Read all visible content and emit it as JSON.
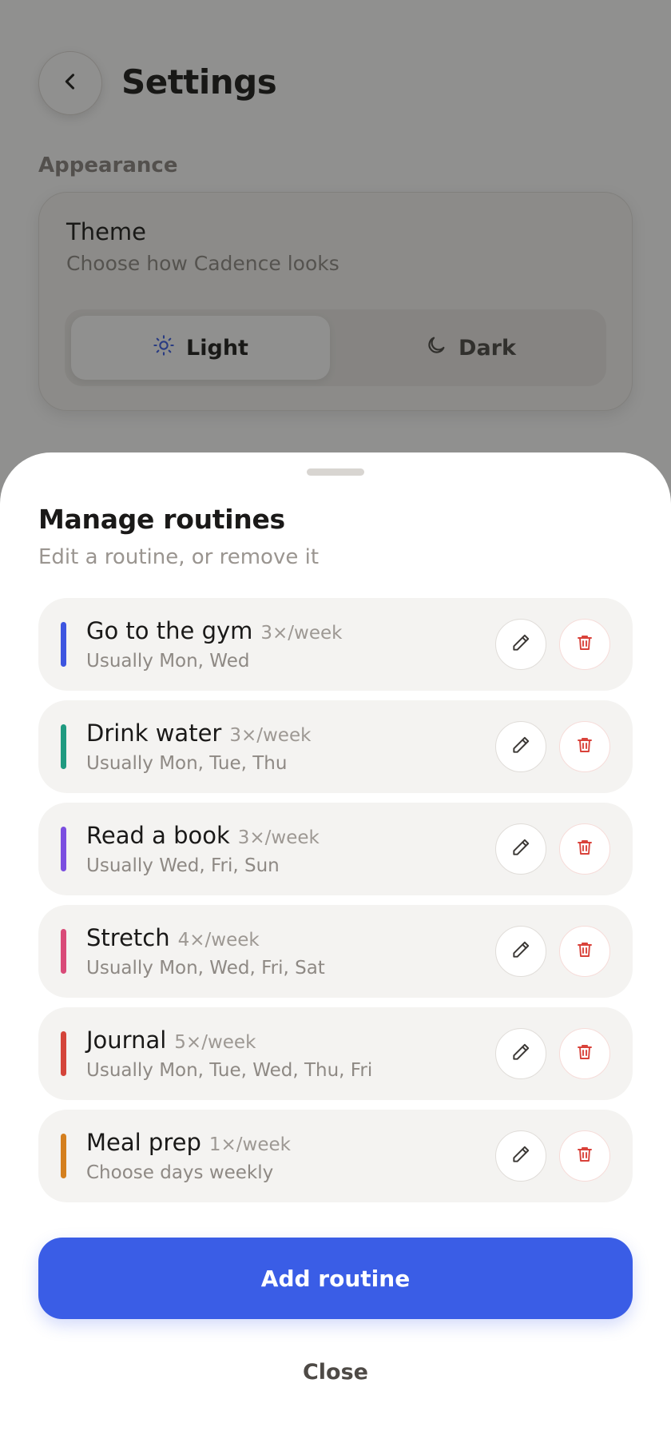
{
  "settings": {
    "title": "Settings",
    "section_appearance": "Appearance",
    "theme": {
      "title": "Theme",
      "subtitle": "Choose how Cadence looks",
      "options": [
        {
          "label": "Light",
          "icon": "sun-icon",
          "selected": true
        },
        {
          "label": "Dark",
          "icon": "moon-icon",
          "selected": false
        }
      ]
    }
  },
  "sheet": {
    "title": "Manage routines",
    "subtitle": "Edit a routine, or remove it",
    "routines": [
      {
        "name": "Go to the gym",
        "frequency": "3×/week",
        "days": "Usually Mon, Wed",
        "color": "#3d55e0"
      },
      {
        "name": "Drink water",
        "frequency": "3×/week",
        "days": "Usually Mon, Tue, Thu",
        "color": "#1f9a80"
      },
      {
        "name": "Read a book",
        "frequency": "3×/week",
        "days": "Usually Wed, Fri, Sun",
        "color": "#7b4ee0"
      },
      {
        "name": "Stretch",
        "frequency": "4×/week",
        "days": "Usually Mon, Wed, Fri, Sat",
        "color": "#d94a78"
      },
      {
        "name": "Journal",
        "frequency": "5×/week",
        "days": "Usually Mon, Tue, Wed, Thu, Fri",
        "color": "#d4443a"
      },
      {
        "name": "Meal prep",
        "frequency": "1×/week",
        "days": "Choose days weekly",
        "color": "#d47f1e"
      }
    ],
    "add_label": "Add routine",
    "close_label": "Close"
  },
  "colors": {
    "accent": "#3a5de6",
    "danger": "#d9423a"
  }
}
